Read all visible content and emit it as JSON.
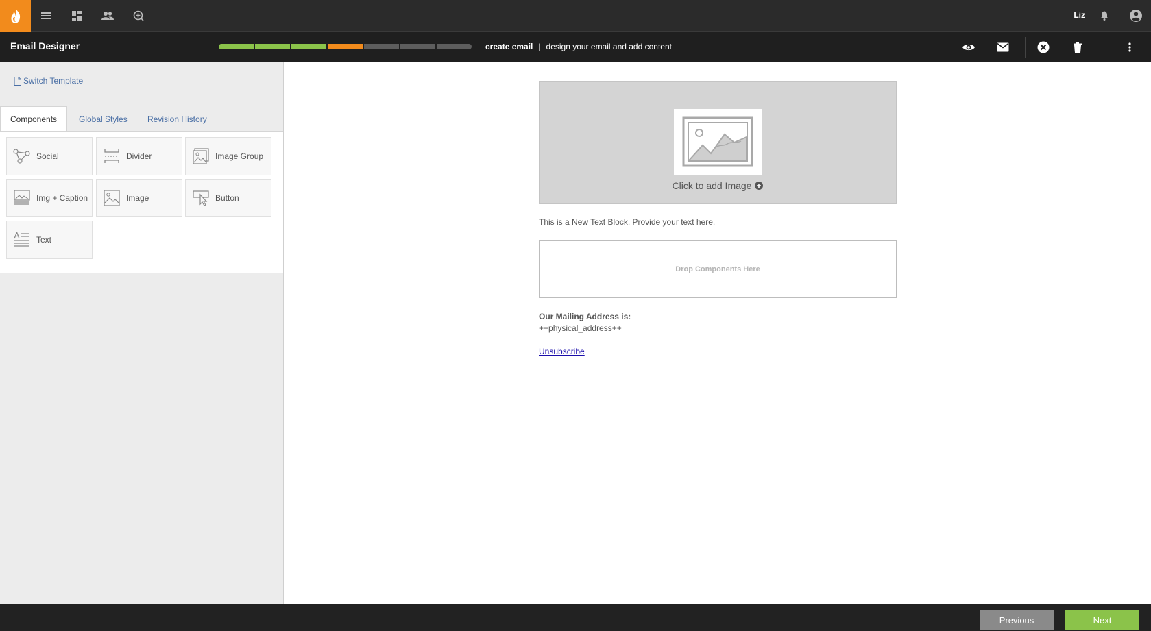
{
  "colors": {
    "accent": "#f28b1c",
    "progress_done": "#8bc34a",
    "progress_current": "#f28b1c",
    "progress_todo": "#5d5d5d",
    "next_button": "#8bc34a"
  },
  "topnav": {
    "logo_icon": "flame-icon",
    "icons": [
      "menu-icon",
      "dashboard-icon",
      "people-icon",
      "add-circle-icon"
    ],
    "user_name": "Liz",
    "right_icons": [
      "bell-icon",
      "account-circle-icon"
    ]
  },
  "header": {
    "title": "Email Designer",
    "progress": {
      "total_steps": 7,
      "completed_steps": 3,
      "current_step": 4
    },
    "step_name": "create email",
    "step_separator": "|",
    "step_description": "design your email and add content",
    "actions": [
      "preview-eye-icon",
      "send-test-email-icon",
      "close-icon",
      "delete-icon",
      "more-vert-icon"
    ]
  },
  "sidebar": {
    "switch_template": "Switch Template",
    "tabs": [
      "Components",
      "Global Styles",
      "Revision History"
    ],
    "active_tab": "Components",
    "components": [
      {
        "label": "Social",
        "icon": "social-icon"
      },
      {
        "label": "Divider",
        "icon": "divider-icon"
      },
      {
        "label": "Image Group",
        "icon": "image-group-icon"
      },
      {
        "label": "Img + Caption",
        "icon": "image-caption-icon"
      },
      {
        "label": "Image",
        "icon": "image-icon"
      },
      {
        "label": "Button",
        "icon": "button-icon"
      },
      {
        "label": "Text",
        "icon": "text-icon"
      }
    ]
  },
  "canvas": {
    "add_image": "Click to add Image",
    "text_block": "This is a New Text Block. Provide your text here.",
    "drop_zone": "Drop Components Here",
    "mailing_heading": "Our Mailing Address is:",
    "mailing_address": "++physical_address++",
    "unsubscribe": "Unsubscribe"
  },
  "footer": {
    "previous": "Previous",
    "next": "Next"
  }
}
